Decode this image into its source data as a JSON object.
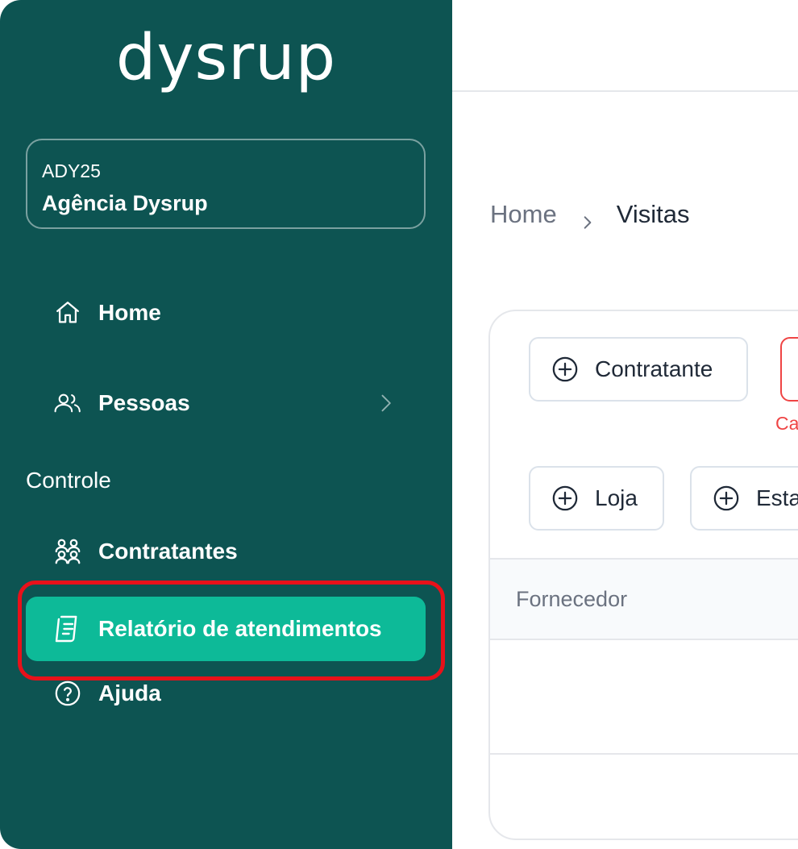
{
  "sidebar": {
    "logo": "dysrup",
    "org": {
      "code": "ADY25",
      "name": "Agência Dysrup"
    },
    "nav": {
      "home": "Home",
      "pessoas": "Pessoas",
      "section_controle": "Controle",
      "contratantes": "Contratantes",
      "relatorio": "Relatório de atendimentos",
      "ajuda": "Ajuda"
    }
  },
  "breadcrumb": {
    "home": "Home",
    "current": "Visitas"
  },
  "filters": {
    "contratante": "Contratante",
    "loja": "Loja",
    "esta": "Esta",
    "red_hint": "Ca"
  },
  "table": {
    "columns": [
      "Fornecedor"
    ]
  },
  "colors": {
    "sidebar_bg": "#0d5452",
    "active_item": "#0dba98",
    "highlight": "#e8111a",
    "error": "#ef4444"
  }
}
